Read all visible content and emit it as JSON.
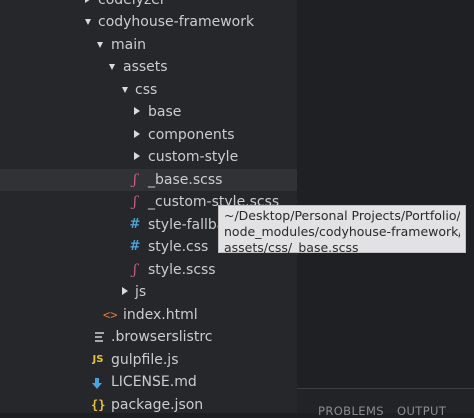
{
  "tree": {
    "codelyzer": "codelyzer",
    "cody_framework": "codyhouse-framework",
    "main": "main",
    "assets": "assets",
    "css": "css",
    "base_folder": "base",
    "components": "components",
    "custom_style": "custom-style",
    "base_scss": "_base.scss",
    "custom_style_scss": "_custom-style.scss",
    "style_fallback": "style-fallback.css",
    "style_css": "style.css",
    "style_scss": "style.scss",
    "js": "js",
    "index_html": "index.html",
    "browserslistrc": ".browserslistrc",
    "gulpfile": "gulpfile.js",
    "license": "LICENSE.md",
    "package_json": "package.json"
  },
  "tooltip": {
    "line1": "~/Desktop/Personal Projects/Portfolio/",
    "line2": "node_modules/codyhouse-framework/main/",
    "line3": "assets/css/_base.scss"
  },
  "panel": {
    "problems": "PROBLEMS",
    "output": "OUTPUT"
  },
  "icons": {
    "scss": "sass-icon",
    "css": "hash-icon",
    "html": "html-icon",
    "js": "js-icon",
    "json": "json-icon",
    "rc": "lines-icon",
    "md": "download-icon"
  }
}
